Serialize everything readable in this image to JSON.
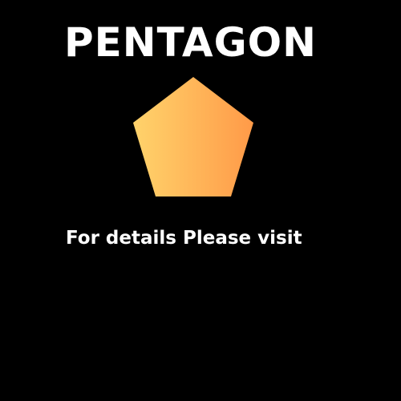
{
  "title": "PENTAGON",
  "caption": "For details Please visit",
  "shape": {
    "name": "pentagon",
    "gradient_start": "#ffd36b",
    "gradient_end": "#ff9a48"
  },
  "colors": {
    "background": "#000000",
    "text": "#ffffff"
  }
}
